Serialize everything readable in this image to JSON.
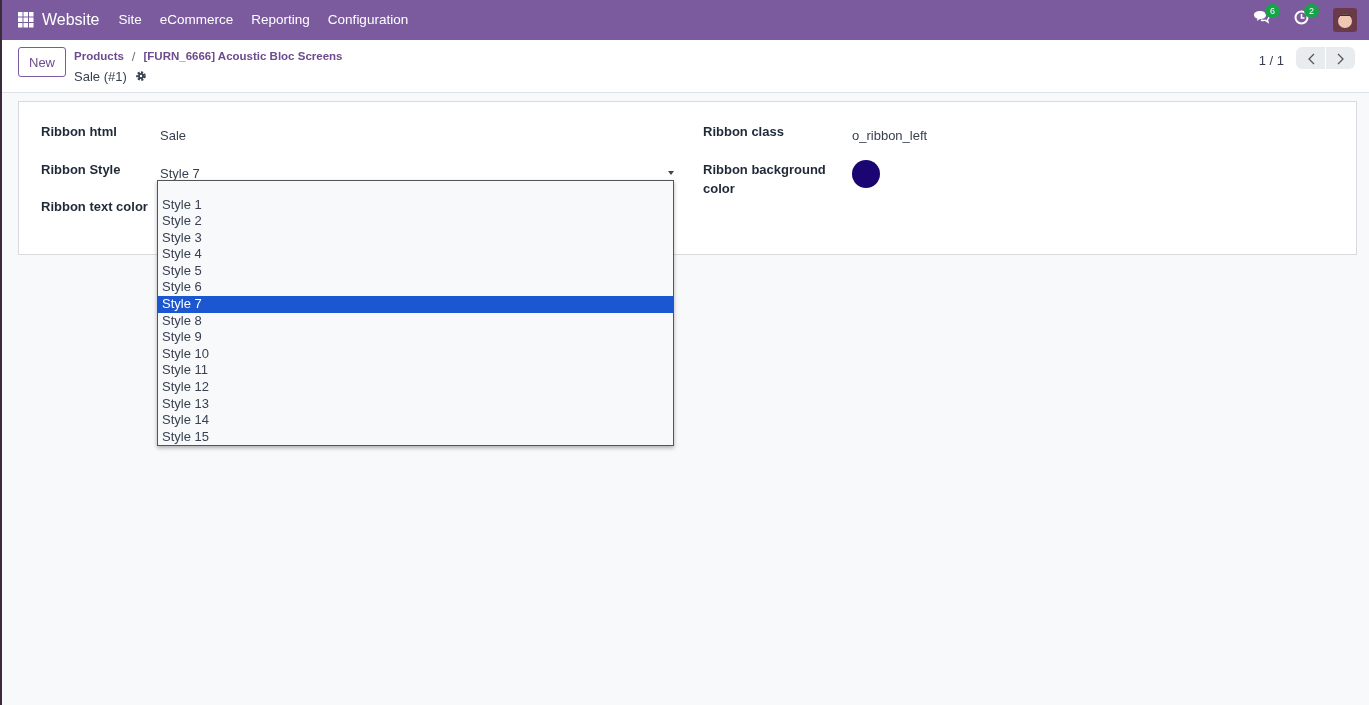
{
  "navbar": {
    "app": "Website",
    "menus": [
      "Site",
      "eCommerce",
      "Reporting",
      "Configuration"
    ],
    "messages_count": "6",
    "activities_count": "2"
  },
  "control_panel": {
    "new_button": "New",
    "breadcrumbs": [
      "Products",
      "[FURN_6666] Acoustic Bloc Screens"
    ],
    "breadcrumb_separator": "/",
    "record_title": "Sale (#1)",
    "pager": "1 / 1"
  },
  "form": {
    "left": [
      {
        "kind": "text",
        "label": "Ribbon html",
        "value": "Sale"
      },
      {
        "kind": "select",
        "label": "Ribbon Style",
        "value": "Style 7"
      },
      {
        "kind": "empty",
        "label": "Ribbon text color"
      }
    ],
    "right": [
      {
        "kind": "text",
        "label": "Ribbon class",
        "value": "o_ribbon_left"
      },
      {
        "kind": "color",
        "label": "Ribbon background color",
        "color": "#1a0573"
      }
    ]
  },
  "dropdown": {
    "options": [
      {
        "label": "Style 1",
        "selected": false
      },
      {
        "label": "Style 2",
        "selected": false
      },
      {
        "label": "Style 3",
        "selected": false
      },
      {
        "label": "Style 4",
        "selected": false
      },
      {
        "label": "Style 5",
        "selected": false
      },
      {
        "label": "Style 6",
        "selected": false
      },
      {
        "label": "Style 7",
        "selected": true
      },
      {
        "label": "Style 8",
        "selected": false
      },
      {
        "label": "Style 9",
        "selected": false
      },
      {
        "label": "Style 10",
        "selected": false
      },
      {
        "label": "Style 11",
        "selected": false
      },
      {
        "label": "Style 12",
        "selected": false
      },
      {
        "label": "Style 13",
        "selected": false
      },
      {
        "label": "Style 14",
        "selected": false
      },
      {
        "label": "Style 15",
        "selected": false
      }
    ]
  }
}
